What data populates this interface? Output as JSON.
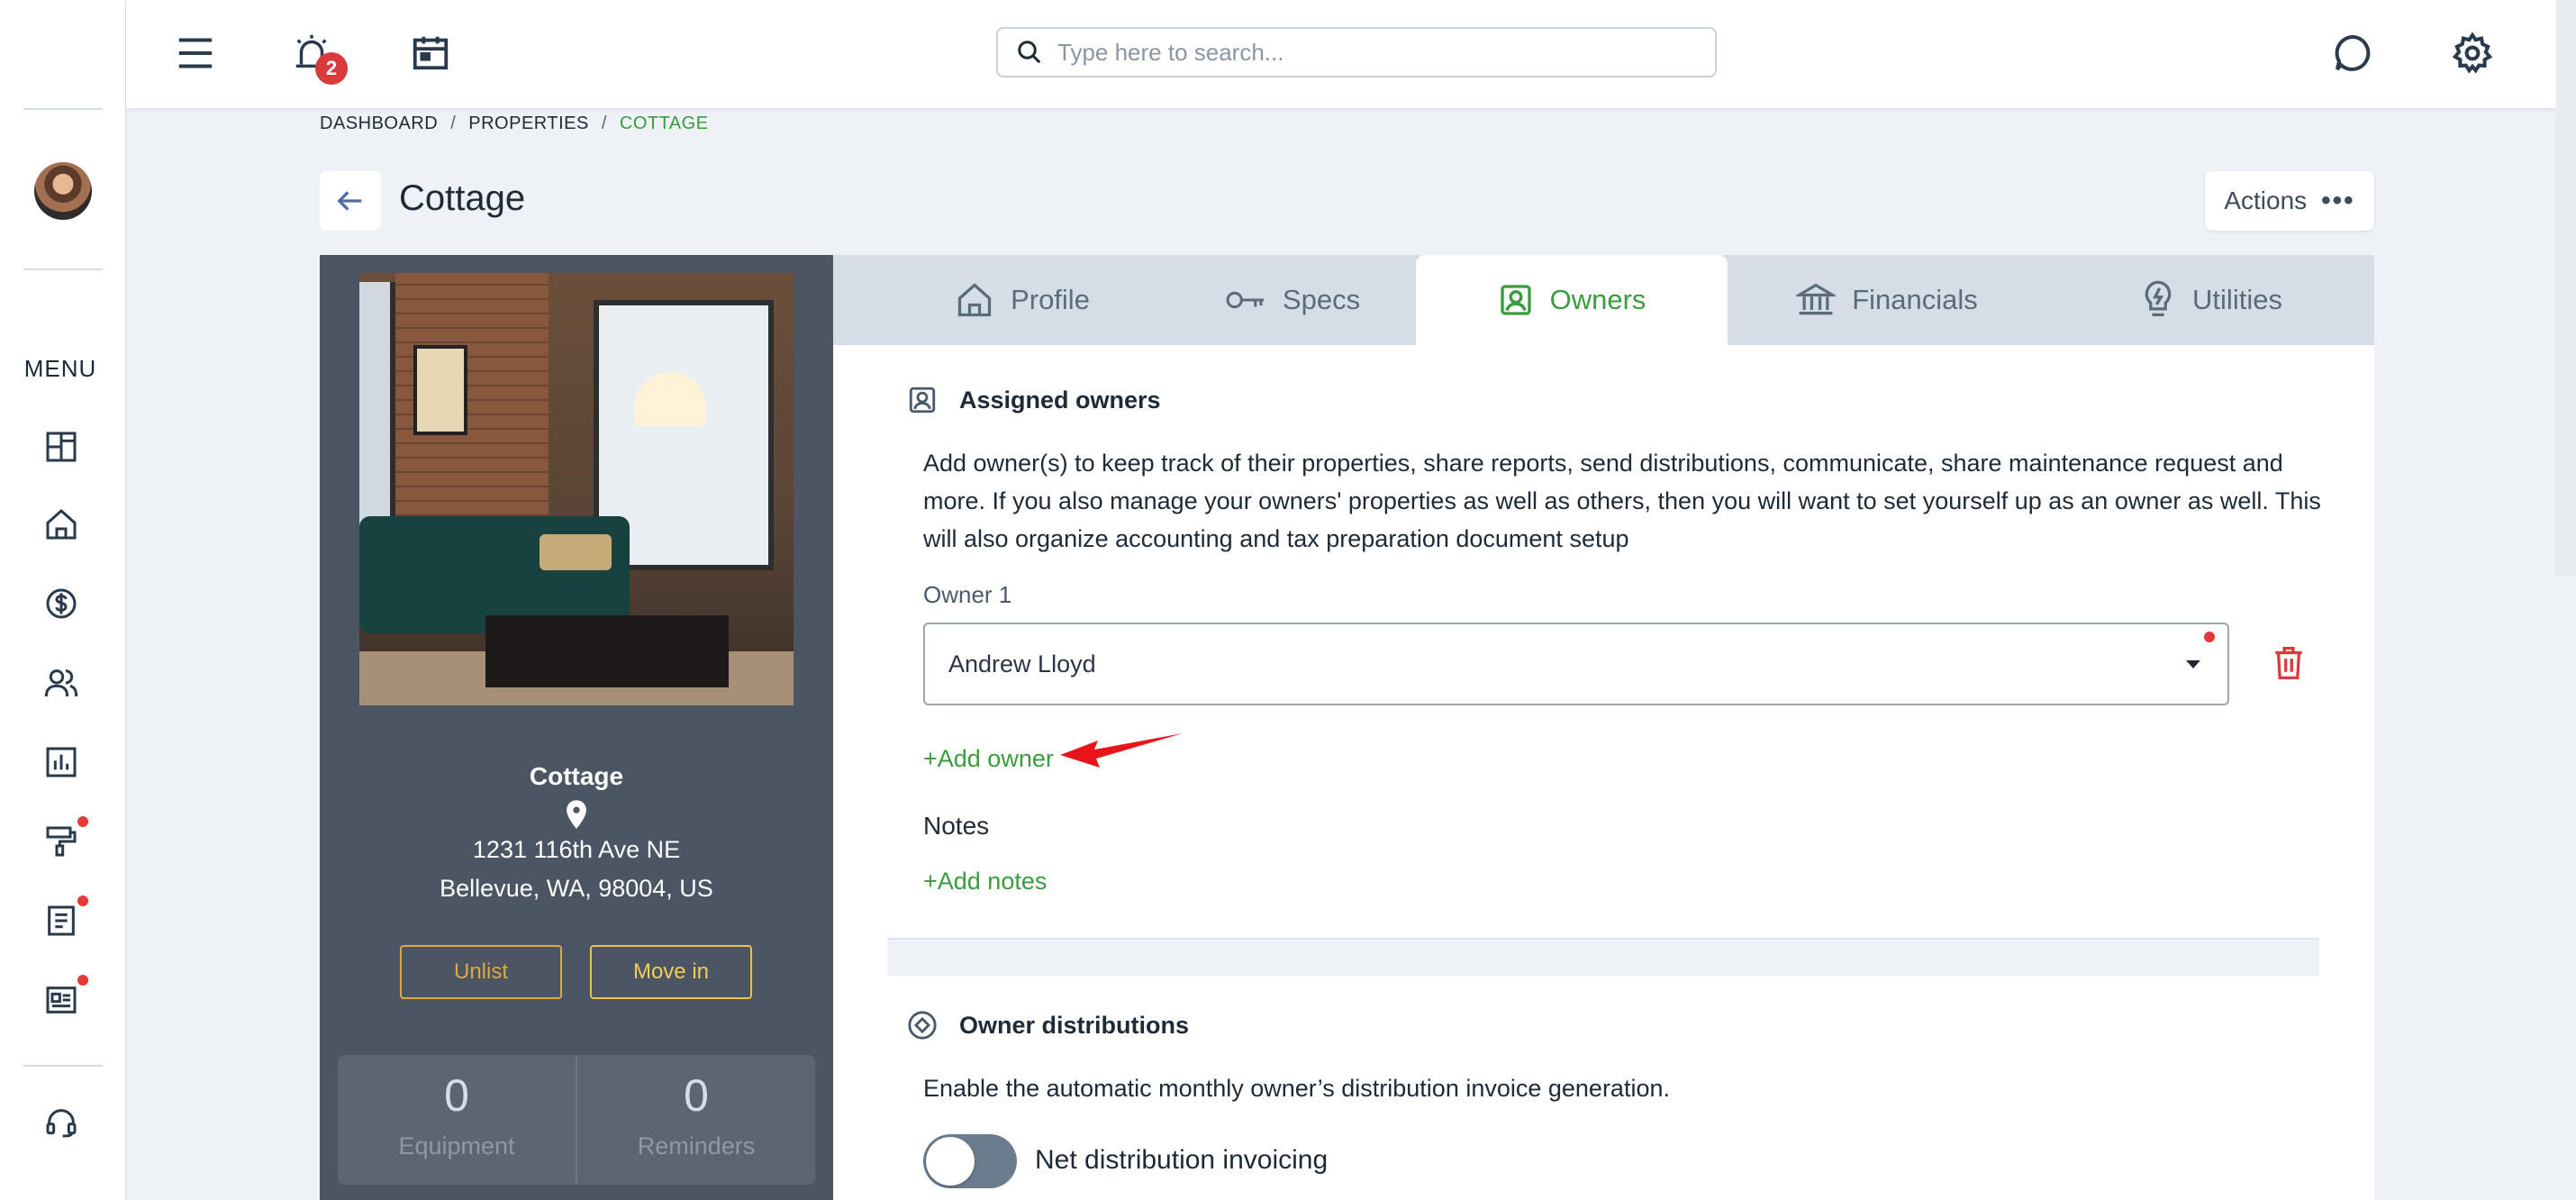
{
  "sidebar": {
    "menu_label": "MENU",
    "items": [
      {
        "icon": "dashboard-icon"
      },
      {
        "icon": "home-icon"
      },
      {
        "icon": "dollar-icon"
      },
      {
        "icon": "users-icon"
      },
      {
        "icon": "chart-icon"
      },
      {
        "icon": "paint-roller-icon",
        "notification": true
      },
      {
        "icon": "document-icon",
        "notification": true
      },
      {
        "icon": "newspaper-icon",
        "notification": true
      },
      {
        "icon": "headset-icon"
      }
    ]
  },
  "topbar": {
    "alerts_count": "2",
    "search_placeholder": "Type here to search..."
  },
  "breadcrumb": {
    "items": [
      "DASHBOARD",
      "PROPERTIES",
      "COTTAGE"
    ]
  },
  "page": {
    "title": "Cottage",
    "actions_label": "Actions"
  },
  "property": {
    "name": "Cottage",
    "address_line1": "1231 116th Ave NE",
    "address_line2": "Bellevue, WA, 98004, US",
    "unlist_label": "Unlist",
    "move_in_label": "Move in",
    "stats": [
      {
        "value": "0",
        "label": "Equipment"
      },
      {
        "value": "0",
        "label": "Reminders"
      }
    ]
  },
  "tabs": [
    {
      "label": "Profile",
      "icon": "home-icon"
    },
    {
      "label": "Specs",
      "icon": "key-icon"
    },
    {
      "label": "Owners",
      "icon": "owner-icon",
      "active": true
    },
    {
      "label": "Financials",
      "icon": "bank-icon"
    },
    {
      "label": "Utilities",
      "icon": "lightbulb-icon"
    }
  ],
  "owners": {
    "section_title": "Assigned owners",
    "description": "Add owner(s) to keep track of their properties, share reports, send distributions, communicate, share maintenance request and more. If you also manage your owners' properties as well as others, then you will want to set yourself up as an owner as well. This will also organize accounting and tax preparation document setup",
    "owner_label": "Owner 1",
    "owner_value": "Andrew Lloyd",
    "add_owner_label": "+Add owner",
    "notes_label": "Notes",
    "add_notes_label": "+Add notes"
  },
  "distributions": {
    "section_title": "Owner distributions",
    "description": "Enable the automatic monthly owner’s distribution invoice generation.",
    "toggle_label": "Net distribution invoicing",
    "toggle_on": false
  },
  "colors": {
    "accent_green": "#3a9b3f",
    "panel_dark": "#4b5563",
    "button_outline": "#e0a93a",
    "alert_red": "#e53935"
  }
}
